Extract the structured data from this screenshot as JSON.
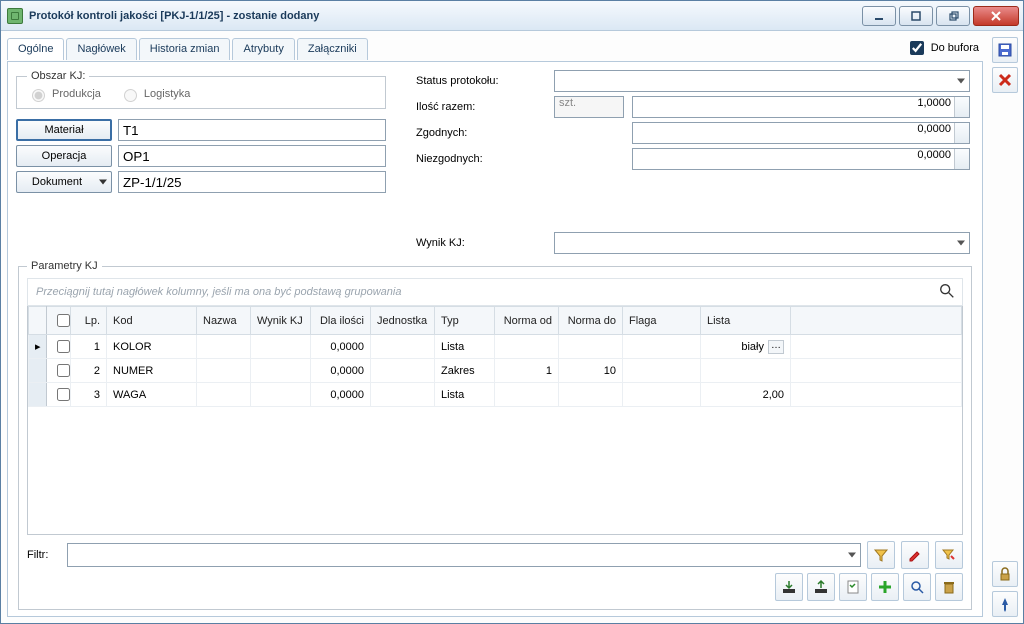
{
  "window": {
    "title": "Protokół kontroli jakości [PKJ-1/1/25] - zostanie dodany"
  },
  "tabs": [
    "Ogólne",
    "Nagłówek",
    "Historia zmian",
    "Atrybuty",
    "Załączniki"
  ],
  "bufor": {
    "label": "Do bufora",
    "checked": true
  },
  "obszar": {
    "legend": "Obszar KJ:",
    "options": [
      "Produkcja",
      "Logistyka"
    ],
    "selected": "Produkcja"
  },
  "left_fields": {
    "material": {
      "label": "Materiał",
      "value": "T1"
    },
    "operacja": {
      "label": "Operacja",
      "value": "OP1"
    },
    "dokument": {
      "label": "Dokument",
      "value": "ZP-1/1/25"
    }
  },
  "right_fields": {
    "status": {
      "label": "Status protokołu:",
      "value": ""
    },
    "ilosc": {
      "label": "Ilość razem:",
      "unit": "szt.",
      "value": "1,0000"
    },
    "zgodnych": {
      "label": "Zgodnych:",
      "value": "0,0000"
    },
    "niezgodnych": {
      "label": "Niezgodnych:",
      "value": "0,0000"
    },
    "wynik": {
      "label": "Wynik KJ:",
      "value": ""
    }
  },
  "params": {
    "legend": "Parametry KJ",
    "group_hint": "Przeciągnij tutaj nagłówek kolumny, jeśli ma ona być podstawą grupowania",
    "columns": [
      "",
      "",
      "Lp.",
      "Kod",
      "Nazwa",
      "Wynik KJ",
      "Dla ilości",
      "Jednostka",
      "Typ",
      "Norma od",
      "Norma do",
      "Flaga",
      "Lista",
      ""
    ],
    "rows": [
      {
        "mark": "▸",
        "lp": "1",
        "kod": "KOLOR",
        "nazwa": "",
        "wynik": "",
        "dla": "0,0000",
        "jedn": "",
        "typ": "Lista",
        "od": "",
        "do": "",
        "flaga": "",
        "lista": "biały",
        "ell": true
      },
      {
        "mark": "",
        "lp": "2",
        "kod": "NUMER",
        "nazwa": "",
        "wynik": "",
        "dla": "0,0000",
        "jedn": "",
        "typ": "Zakres",
        "od": "1",
        "do": "10",
        "flaga": "",
        "lista": "",
        "ell": false
      },
      {
        "mark": "",
        "lp": "3",
        "kod": "WAGA",
        "nazwa": "",
        "wynik": "",
        "dla": "0,0000",
        "jedn": "",
        "typ": "Lista",
        "od": "",
        "do": "",
        "flaga": "",
        "lista": "2,00",
        "ell": false
      }
    ]
  },
  "filter": {
    "label": "Filtr:"
  }
}
